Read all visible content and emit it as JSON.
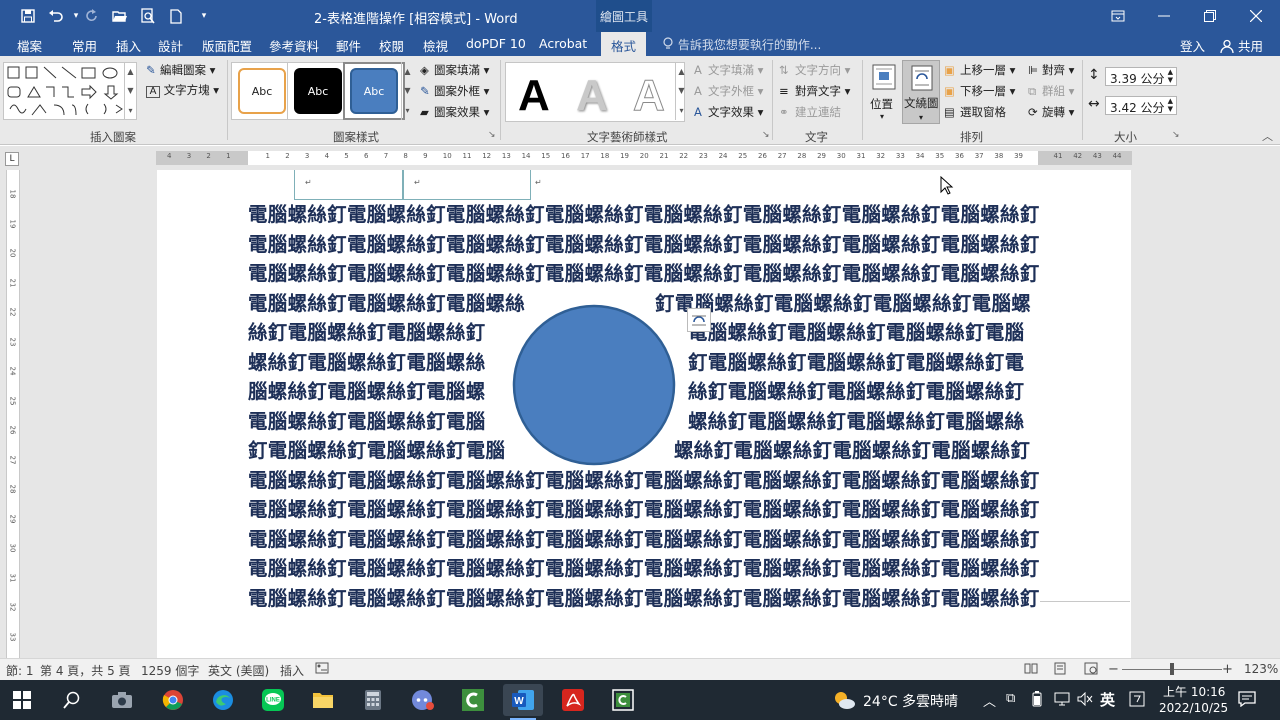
{
  "titlebar": {
    "title": "2-表格進階操作 [相容模式] - Word",
    "tools_label": "繪圖工具",
    "quick_access": [
      "save-icon",
      "undo-icon",
      "redo-icon",
      "open-icon",
      "print-preview-icon",
      "new-doc-icon",
      "customize-icon"
    ]
  },
  "tabs": [
    {
      "label": "檔案"
    },
    {
      "label": "常用"
    },
    {
      "label": "插入"
    },
    {
      "label": "設計"
    },
    {
      "label": "版面配置"
    },
    {
      "label": "參考資料"
    },
    {
      "label": "郵件"
    },
    {
      "label": "校閱"
    },
    {
      "label": "檢視"
    },
    {
      "label": "doPDF 10"
    },
    {
      "label": "Acrobat"
    },
    {
      "label": "格式"
    }
  ],
  "active_tab": "格式",
  "tellme_placeholder": "告訴我您想要執行的動作...",
  "account": {
    "signin": "登入",
    "share": "共用"
  },
  "ribbon": {
    "insert_shapes": {
      "label": "插入圖案",
      "edit_shape": "編輯圖案",
      "text_box": "文字方塊"
    },
    "shape_styles": {
      "label": "圖案樣式",
      "preset_text": "Abc",
      "fill": "圖案填滿",
      "outline": "圖案外框",
      "effects": "圖案效果"
    },
    "wordart_styles": {
      "label": "文字藝術師樣式",
      "sample": "A",
      "text_fill": "文字填滿",
      "text_outline": "文字外框",
      "text_effects": "文字效果"
    },
    "text": {
      "label": "文字",
      "direction": "文字方向",
      "align": "對齊文字",
      "link": "建立連結"
    },
    "arrange": {
      "label": "排列",
      "position": "位置",
      "wrap": "文繞圖",
      "bring_forward": "上移一層",
      "send_backward": "下移一層",
      "selection_pane": "選取窗格",
      "align": "對齊",
      "group": "群組",
      "rotate": "旋轉"
    },
    "size": {
      "label": "大小",
      "height": "3.39 公分",
      "width": "3.42 公分"
    }
  },
  "ruler_numbers": [
    "4",
    "3",
    "2",
    "1",
    "",
    "1",
    "2",
    "3",
    "4",
    "5",
    "6",
    "7",
    "8",
    "9",
    "10",
    "11",
    "12",
    "13",
    "14",
    "15",
    "16",
    "17",
    "18",
    "19",
    "20",
    "21",
    "22",
    "23",
    "24",
    "25",
    "26",
    "27",
    "28",
    "29",
    "30",
    "31",
    "32",
    "33",
    "34",
    "35",
    "36",
    "37",
    "38",
    "39",
    "",
    "41",
    "42",
    "43",
    "44"
  ],
  "vruler_numbers": [
    "18",
    "19",
    "20",
    "21",
    "22",
    "23",
    "24",
    "25",
    "26",
    "27",
    "28",
    "29",
    "30",
    "31",
    "32",
    "33"
  ],
  "document": {
    "full_lines": [
      "電腦螺絲釘電腦螺絲釘電腦螺絲釘電腦螺絲釘電腦螺絲釘電腦螺絲釘電腦螺絲釘電腦螺絲釘",
      "電腦螺絲釘電腦螺絲釘電腦螺絲釘電腦螺絲釘電腦螺絲釘電腦螺絲釘電腦螺絲釘電腦螺絲釘",
      "電腦螺絲釘電腦螺絲釘電腦螺絲釘電腦螺絲釘電腦螺絲釘電腦螺絲釘電腦螺絲釘電腦螺絲釘"
    ],
    "wrap_lines": [
      {
        "left": "電腦螺絲釘電腦螺絲釘電腦螺絲",
        "right": "釘電腦螺絲釘電腦螺絲釘電腦螺絲釘電腦螺"
      },
      {
        "left": "絲釘電腦螺絲釘電腦螺絲釘",
        "right": "電腦螺絲釘電腦螺絲釘電腦螺絲釘電腦"
      },
      {
        "left": "螺絲釘電腦螺絲釘電腦螺絲",
        "right": "釘電腦螺絲釘電腦螺絲釘電腦螺絲釘電"
      },
      {
        "left": "腦螺絲釘電腦螺絲釘電腦螺",
        "right": "絲釘電腦螺絲釘電腦螺絲釘電腦螺絲釘"
      },
      {
        "left": "電腦螺絲釘電腦螺絲釘電腦",
        "right": "螺絲釘電腦螺絲釘電腦螺絲釘電腦螺絲"
      },
      {
        "left": "釘電腦螺絲釘電腦螺絲釘電腦",
        "right": "螺絲釘電腦螺絲釘電腦螺絲釘電腦螺絲釘"
      }
    ],
    "after_lines": [
      "電腦螺絲釘電腦螺絲釘電腦螺絲釘電腦螺絲釘電腦螺絲釘電腦螺絲釘電腦螺絲釘電腦螺絲釘",
      "電腦螺絲釘電腦螺絲釘電腦螺絲釘電腦螺絲釘電腦螺絲釘電腦螺絲釘電腦螺絲釘電腦螺絲釘",
      "電腦螺絲釘電腦螺絲釘電腦螺絲釘電腦螺絲釘電腦螺絲釘電腦螺絲釘電腦螺絲釘電腦螺絲釘",
      "電腦螺絲釘電腦螺絲釘電腦螺絲釘電腦螺絲釘電腦螺絲釘電腦螺絲釘電腦螺絲釘電腦螺絲釘",
      "電腦螺絲釘電腦螺絲釘電腦螺絲釘電腦螺絲釘電腦螺絲釘電腦螺絲釘電腦螺絲釘電腦螺絲釘"
    ],
    "text_color": "#1d2f57",
    "shape_fill": "#4a7ebf",
    "shape_outline": "#2f5f95"
  },
  "statusbar": {
    "section": "節: 1",
    "page": "第 4 頁，共 5 頁",
    "words": "1259 個字",
    "language": "英文 (美國)",
    "mode": "插入",
    "zoom": "123%"
  },
  "taskbar": {
    "weather": "24°C 多雲時晴",
    "ime": "英",
    "time": "上午 10:16",
    "date": "2022/10/25"
  }
}
